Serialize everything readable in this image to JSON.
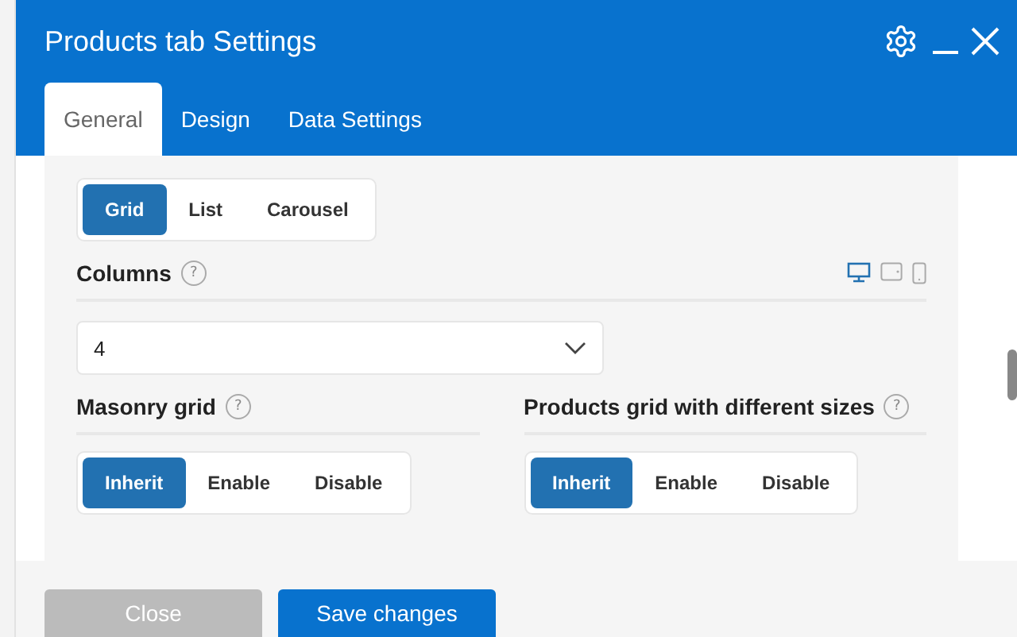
{
  "window": {
    "title": "Products tab Settings"
  },
  "tabs": [
    {
      "label": "General",
      "selected": true
    },
    {
      "label": "Design",
      "selected": false
    },
    {
      "label": "Data Settings",
      "selected": false
    }
  ],
  "layout_options": [
    {
      "label": "Grid",
      "selected": true
    },
    {
      "label": "List",
      "selected": false
    },
    {
      "label": "Carousel",
      "selected": false
    }
  ],
  "columns": {
    "label": "Columns",
    "help": "?",
    "devices": [
      {
        "kind": "desktop",
        "selected": true
      },
      {
        "kind": "tablet",
        "selected": false
      },
      {
        "kind": "mobile",
        "selected": false
      }
    ],
    "value": "4"
  },
  "toggles": [
    {
      "label": "Masonry grid",
      "help": "?",
      "options": [
        {
          "label": "Inherit",
          "selected": true
        },
        {
          "label": "Enable",
          "selected": false
        },
        {
          "label": "Disable",
          "selected": false
        }
      ]
    },
    {
      "label": "Products grid with different sizes",
      "help": "?",
      "options": [
        {
          "label": "Inherit",
          "selected": true
        },
        {
          "label": "Enable",
          "selected": false
        },
        {
          "label": "Disable",
          "selected": false
        }
      ]
    }
  ],
  "buttons": [
    {
      "label": "Close",
      "kind": "secondary"
    },
    {
      "label": "Save changes",
      "kind": "primary"
    }
  ]
}
